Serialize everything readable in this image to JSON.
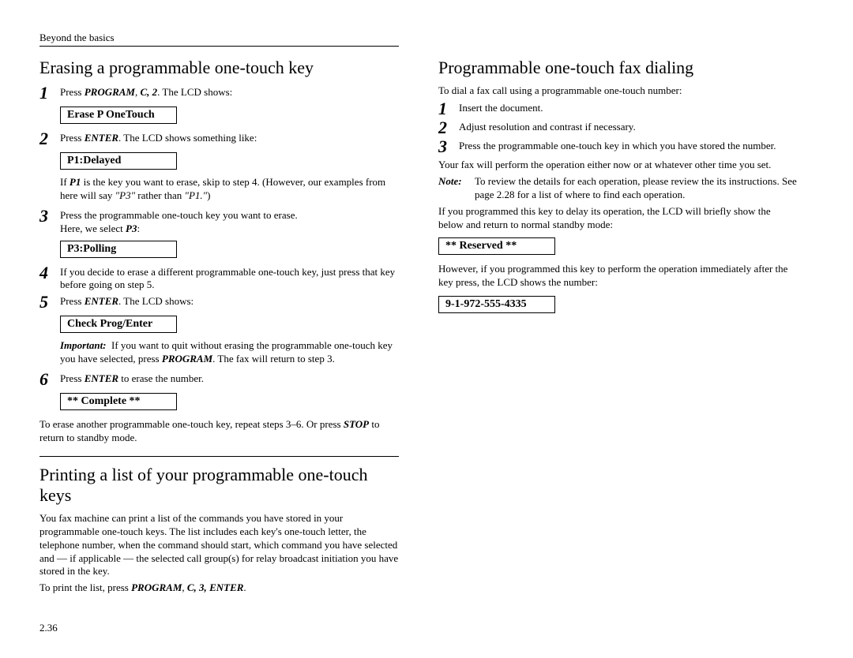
{
  "header": "Beyond the basics",
  "page_number": "2.36",
  "left": {
    "h1": "Erasing a programmable one-touch key",
    "step1": "Press PROGRAM, C, 2. The LCD shows:",
    "lcd1": "Erase P OneTouch",
    "step2": "Press ENTER. The LCD shows something like:",
    "lcd2": "P1:Delayed",
    "note2": "If P1 is the key you want to erase, skip to step 4. (However, our examples from here will say \"P3\" rather than \"P1.\")",
    "step3a": "Press the programmable one-touch key you want to erase.",
    "step3b": "Here, we select P3:",
    "lcd3": "P3:Polling",
    "step4": "If you decide to erase a different programmable one-touch key, just press that key before going on step 5.",
    "step5": "Press ENTER. The LCD shows:",
    "lcd5": "Check Prog/Enter",
    "important": "If you want to quit without erasing the programmable one-touch key you have selected, press PROGRAM. The fax will return to step 3.",
    "step6": "Press ENTER to erase the number.",
    "lcd6": "**  Complete  **",
    "tail": "To erase another programmable one-touch key, repeat steps 3–6. Or press STOP to return to standby mode.",
    "h2": "Printing a list of your programmable one-touch keys",
    "para1": "You fax machine can print a list of the commands you have stored in your programmable one-touch keys. The list includes each key's one-touch letter, the telephone number, when the command should start, which command you have selected and — if applicable — the selected call group(s) for relay broadcast initiation you have stored in the key.",
    "para2": "To print the list, press PROGRAM, C, 3, ENTER."
  },
  "right": {
    "h1": "Programmable one-touch fax dialing",
    "intro": "To dial a fax call using a programmable one-touch number:",
    "step1": "Insert the document.",
    "step2": "Adjust resolution and contrast if necessary.",
    "step3": "Press the programmable one-touch key in which you have stored the number.",
    "after": "Your fax will perform the operation either now or at whatever other time you set.",
    "note": "To review the details for each operation, please review the its instructions. See page 2.28 for a list of where to find each operation.",
    "delay": "If you programmed this key to delay its operation, the LCD will briefly show the below and return to normal standby mode:",
    "lcd1": "** Reserved **",
    "immediate": "However, if you programmed this key to perform the operation immediately after the key press, the LCD shows the number:",
    "lcd2": "9-1-972-555-4335"
  }
}
